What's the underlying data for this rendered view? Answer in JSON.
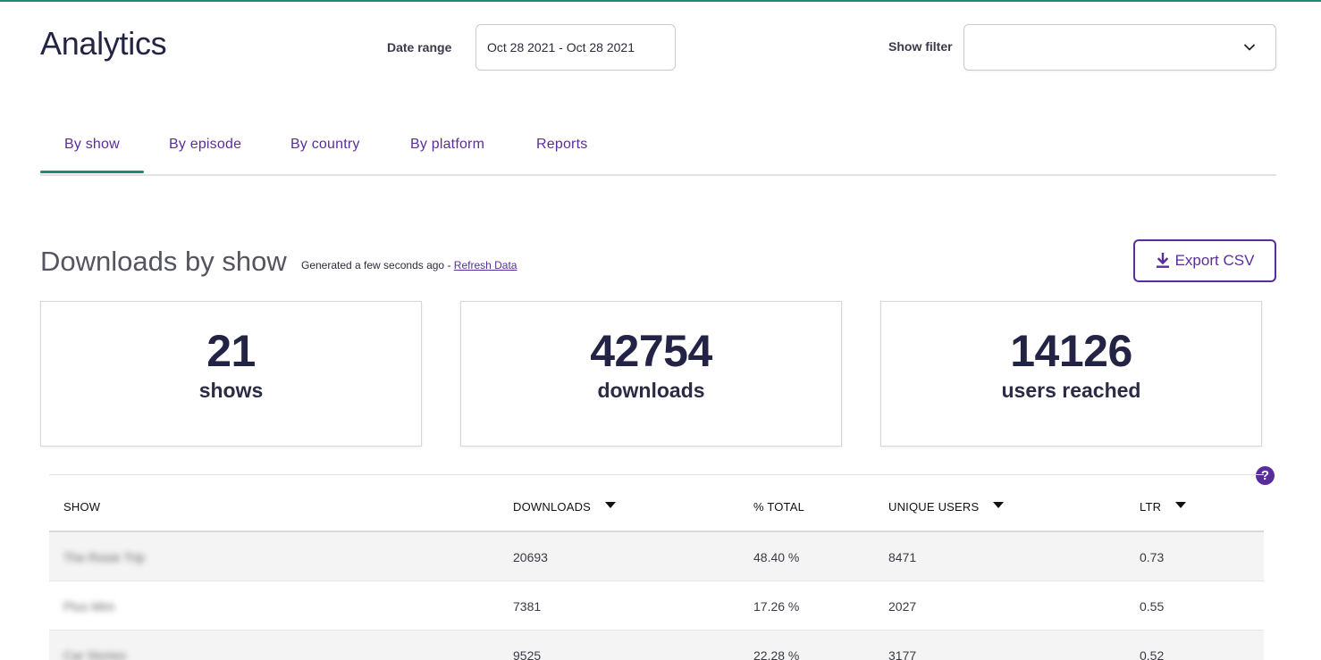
{
  "page": {
    "title": "Analytics"
  },
  "filters": {
    "date_label": "Date range",
    "date_value": "Oct 28 2021 - Oct 28 2021",
    "show_filter_label": "Show filter",
    "show_filter_value": ""
  },
  "tabs": [
    {
      "label": "By show",
      "active": true
    },
    {
      "label": "By episode"
    },
    {
      "label": "By country"
    },
    {
      "label": "By platform"
    },
    {
      "label": "Reports"
    }
  ],
  "section": {
    "title": "Downloads by show",
    "generated": "Generated a few seconds ago - ",
    "refresh_link": "Refresh Data",
    "export_label": "Export CSV"
  },
  "stats": [
    {
      "value": "21",
      "label": "shows"
    },
    {
      "value": "42754",
      "label": "downloads"
    },
    {
      "value": "14126",
      "label": "users reached"
    }
  ],
  "table": {
    "headers": [
      "SHOW",
      "DOWNLOADS",
      "% TOTAL",
      "UNIQUE USERS",
      "LTR"
    ],
    "rows": [
      {
        "show": "The Rosie Trip",
        "downloads": "20693",
        "pct": "48.40 %",
        "users": "8471",
        "ltr": "0.73"
      },
      {
        "show": "Plus Mini",
        "downloads": "7381",
        "pct": "17.26 %",
        "users": "2027",
        "ltr": "0.55"
      },
      {
        "show": "Car Stories",
        "downloads": "9525",
        "pct": "22.28 %",
        "users": "3177",
        "ltr": "0.52"
      }
    ]
  },
  "colors": {
    "accent": "#5a2d9c",
    "active_tab": "#1e8a6e",
    "text": "#232345"
  }
}
